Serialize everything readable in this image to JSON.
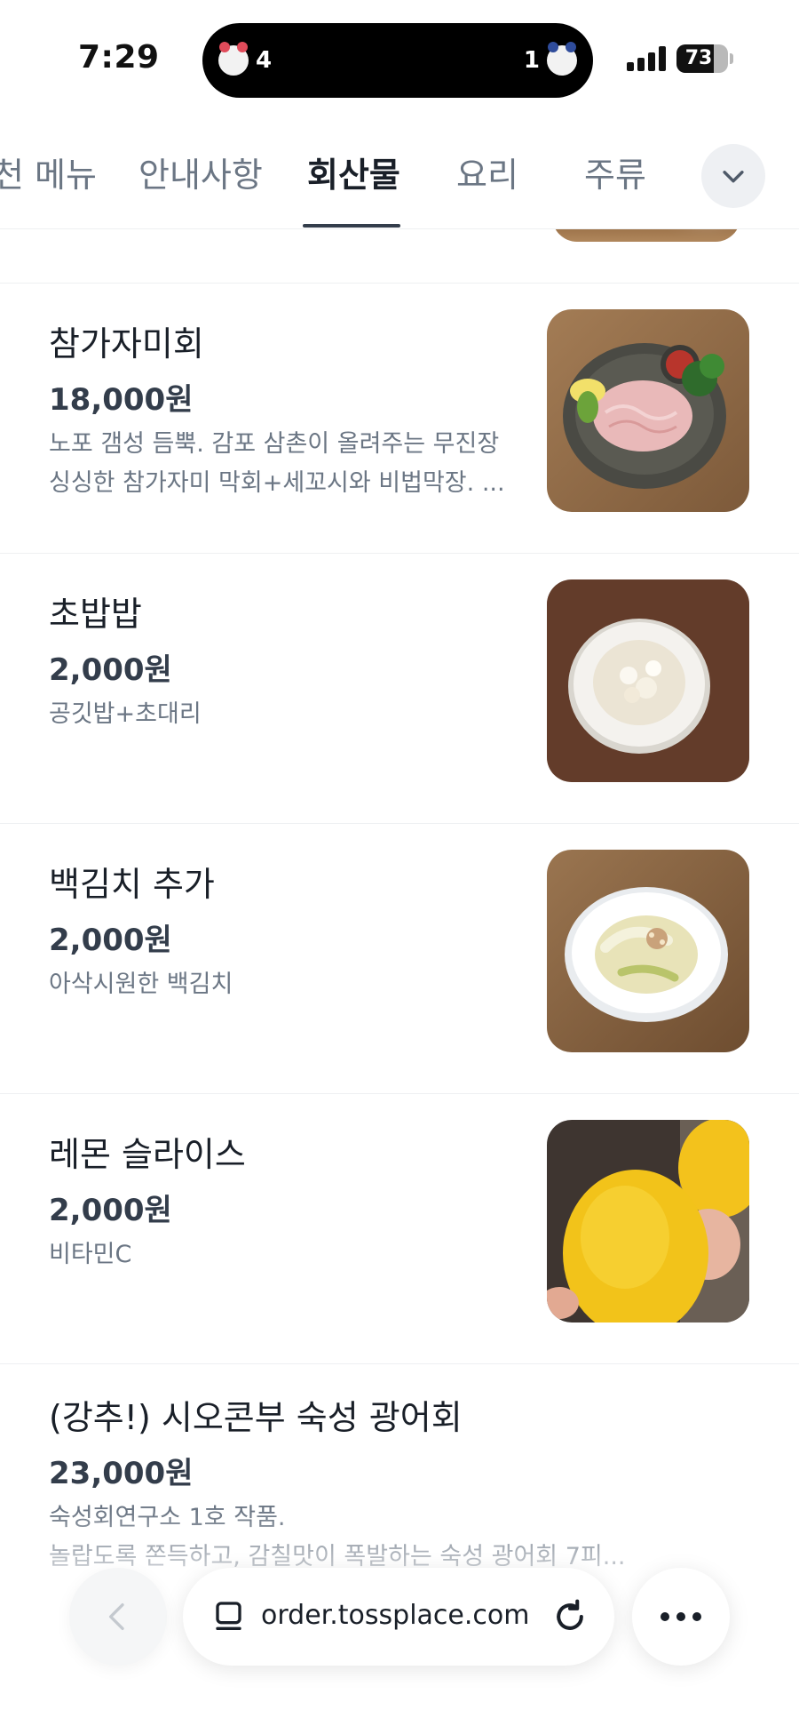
{
  "status_bar": {
    "time": "7:29",
    "island_left_count": "4",
    "island_right_count": "1",
    "battery_percent": "73",
    "battery_level": 0.73
  },
  "tabs": [
    {
      "label": "천 메뉴",
      "active": false
    },
    {
      "label": "안내사항",
      "active": false
    },
    {
      "label": "회산물",
      "active": true
    },
    {
      "label": "요리",
      "active": false
    },
    {
      "label": "주류",
      "active": false
    }
  ],
  "menu_items": [
    {
      "name": "참가자미회",
      "price": "18,000원",
      "desc_lines": [
        "노포 갬성 듬뿍. 감포 삼촌이 올려주는 무진장",
        "싱싱한 참가자미 막회+세꼬시와 비법막장. ..."
      ],
      "image": "dish-flounder-sashimi"
    },
    {
      "name": "초밥밥",
      "price": "2,000원",
      "desc_lines": [
        "공깃밥+초대리"
      ],
      "image": "dish-rice-bowl"
    },
    {
      "name": "백김치 추가",
      "price": "2,000원",
      "desc_lines": [
        "아삭시원한 백김치"
      ],
      "image": "dish-white-kimchi"
    },
    {
      "name": "레몬 슬라이스",
      "price": "2,000원",
      "desc_lines": [
        "비타민C"
      ],
      "image": "lemon"
    },
    {
      "name": "(강추!) 시오콘부 숙성 광어회",
      "price": "23,000원",
      "desc_lines": [
        "숙성회연구소 1호 작품.",
        "놀랍도록 쫀득하고, 감칠맛이 폭발하는 숙성 광어회 7피..."
      ],
      "image": ""
    }
  ],
  "browser_bar": {
    "url": "order.tossplace.com",
    "back_icon": "chevron-left-icon",
    "tabs_icon": "tabs-icon",
    "reload_icon": "reload-icon",
    "more_icon": "more-dots-icon"
  },
  "colors": {
    "text_primary": "#191f28",
    "text_secondary": "#6b7684",
    "divider": "#eef0f2"
  }
}
